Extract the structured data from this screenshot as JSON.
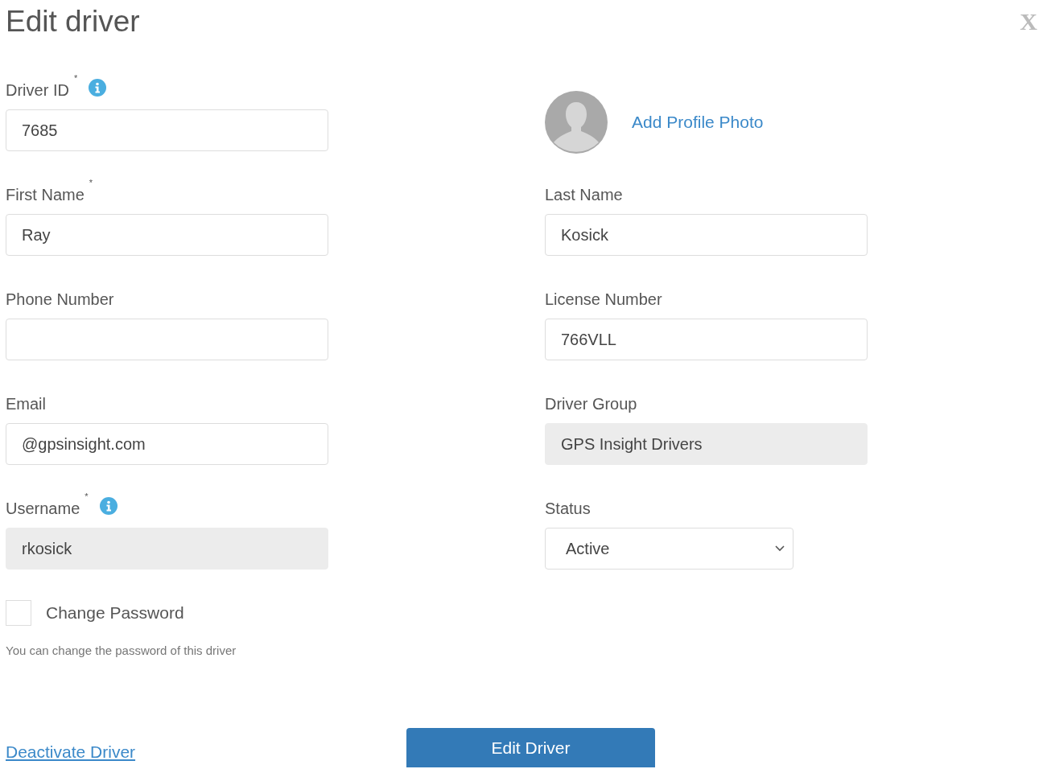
{
  "dialog": {
    "title": "Edit driver",
    "close": "X"
  },
  "fields": [
    {
      "kind": "input",
      "label": "Driver ID",
      "mark": "*",
      "info": true,
      "value": "7685"
    },
    {
      "kind": "photo",
      "link": "Add Profile Photo"
    },
    {
      "kind": "input",
      "label": "First Name",
      "mark": "*",
      "value": "Ray"
    },
    {
      "kind": "input",
      "label": "Last Name",
      "value": "Kosick"
    },
    {
      "kind": "input",
      "label": "Phone Number"
    },
    {
      "kind": "input",
      "label": "License Number",
      "value": "766VLL"
    },
    {
      "kind": "input",
      "label": "Email",
      "value": "@gpsinsight.com"
    },
    {
      "kind": "readonly",
      "label": "Driver Group",
      "value": "GPS Insight Drivers"
    },
    {
      "kind": "readonly",
      "label": "Username",
      "mark": "*",
      "info": true,
      "value": "rkosick"
    },
    {
      "kind": "select",
      "label": "Status",
      "value": "Active"
    }
  ],
  "change_password": {
    "label": "Change Password",
    "checked": false,
    "help": "You can change the password of this driver"
  },
  "deactivate_link": "Deactivate Driver",
  "submit_button": "Edit Driver"
}
